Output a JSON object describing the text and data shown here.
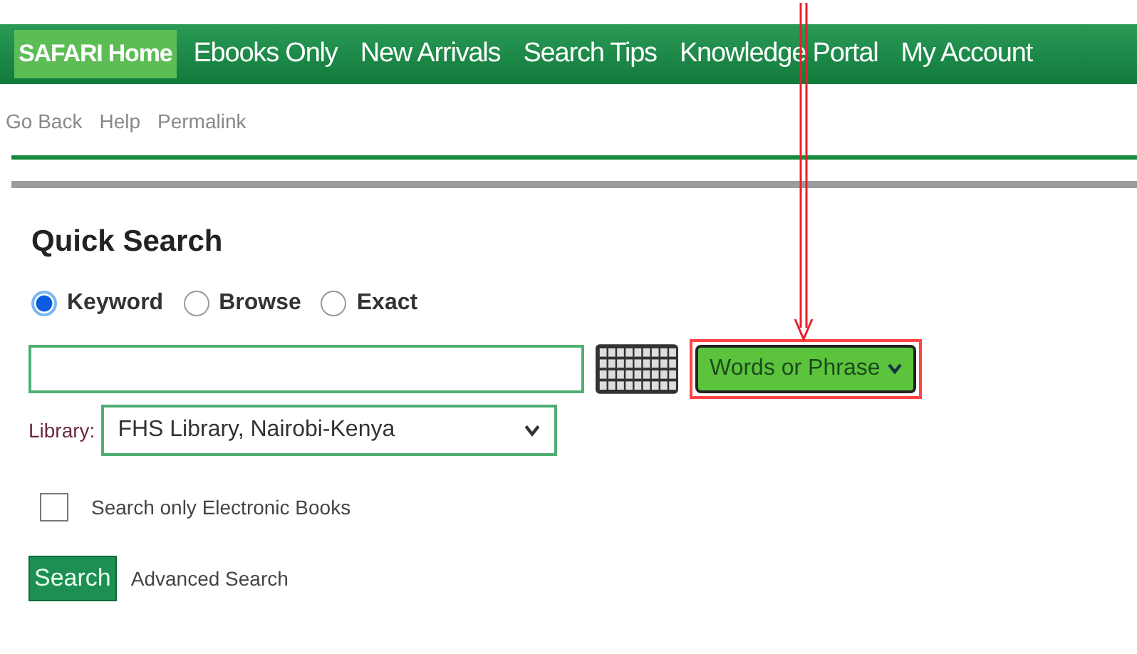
{
  "nav": [
    {
      "label": "SAFARI Home",
      "selected": true
    },
    {
      "label": "Ebooks Only",
      "selected": false
    },
    {
      "label": "New Arrivals",
      "selected": false
    },
    {
      "label": "Search Tips",
      "selected": false
    },
    {
      "label": "Knowledge Portal",
      "selected": false
    },
    {
      "label": "My Account",
      "selected": false
    }
  ],
  "sub_links": [
    "Go Back",
    "Help",
    "Permalink"
  ],
  "quick_search": {
    "title": "Quick Search",
    "modes": [
      {
        "label": "Keyword",
        "selected": true
      },
      {
        "label": "Browse",
        "selected": false
      },
      {
        "label": "Exact",
        "selected": false
      }
    ],
    "match_type": {
      "value": "Words or Phrase",
      "highlighted": true
    },
    "library_label": "Library:",
    "library": "FHS Library, Nairobi-Kenya",
    "ebooks_only": {
      "label": "Search only Electronic Books",
      "checked": false
    },
    "search_button": "Search",
    "advanced_link": "Advanced Search"
  }
}
